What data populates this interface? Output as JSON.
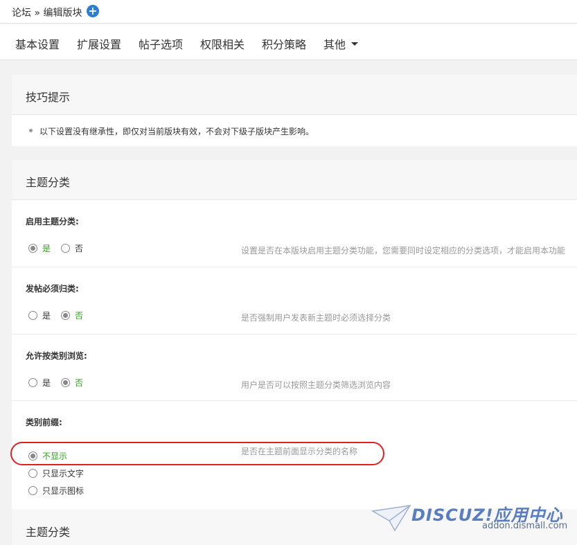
{
  "header": {
    "breadcrumb": "论坛 » 编辑版块",
    "add_icon": "plus-circle-icon",
    "add_glyph": "+"
  },
  "tabs": [
    {
      "label": "基本设置"
    },
    {
      "label": "扩展设置"
    },
    {
      "label": "帖子选项"
    },
    {
      "label": "权限相关"
    },
    {
      "label": "积分策略"
    },
    {
      "label": "其他"
    }
  ],
  "tips": {
    "title": "技巧提示",
    "text": "以下设置没有继承性，即仅对当前版块有效，不会对下级子版块产生影响。"
  },
  "section": {
    "title": "主题分类",
    "settings": [
      {
        "label": "启用主题分类:",
        "options": [
          "是",
          "否"
        ],
        "selected": "是",
        "description": "设置是否在本版块启用主题分类功能，您需要同时设定相应的分类选项，才能启用本功能"
      },
      {
        "label": "发帖必须归类:",
        "options": [
          "是",
          "否"
        ],
        "selected": "否",
        "description": "是否强制用户发表新主题时必须选择分类"
      },
      {
        "label": "允许按类别浏览:",
        "options": [
          "是",
          "否"
        ],
        "selected": "否",
        "description": "用户是否可以按照主题分类筛选浏览内容"
      },
      {
        "label": "类别前缀:",
        "options": [
          "不显示",
          "只显示文字",
          "只显示图标"
        ],
        "selected": "不显示",
        "description": "是否在主题前面显示分类的名称"
      }
    ]
  },
  "next_section": {
    "title": "主题分类"
  },
  "watermark": {
    "brand": "DISCUZ!应用中心",
    "url": "addon.dismall.com"
  },
  "colors": {
    "selected_text": "#2aa515",
    "highlight_border": "#e02020",
    "add_button": "#2a7fd4"
  }
}
